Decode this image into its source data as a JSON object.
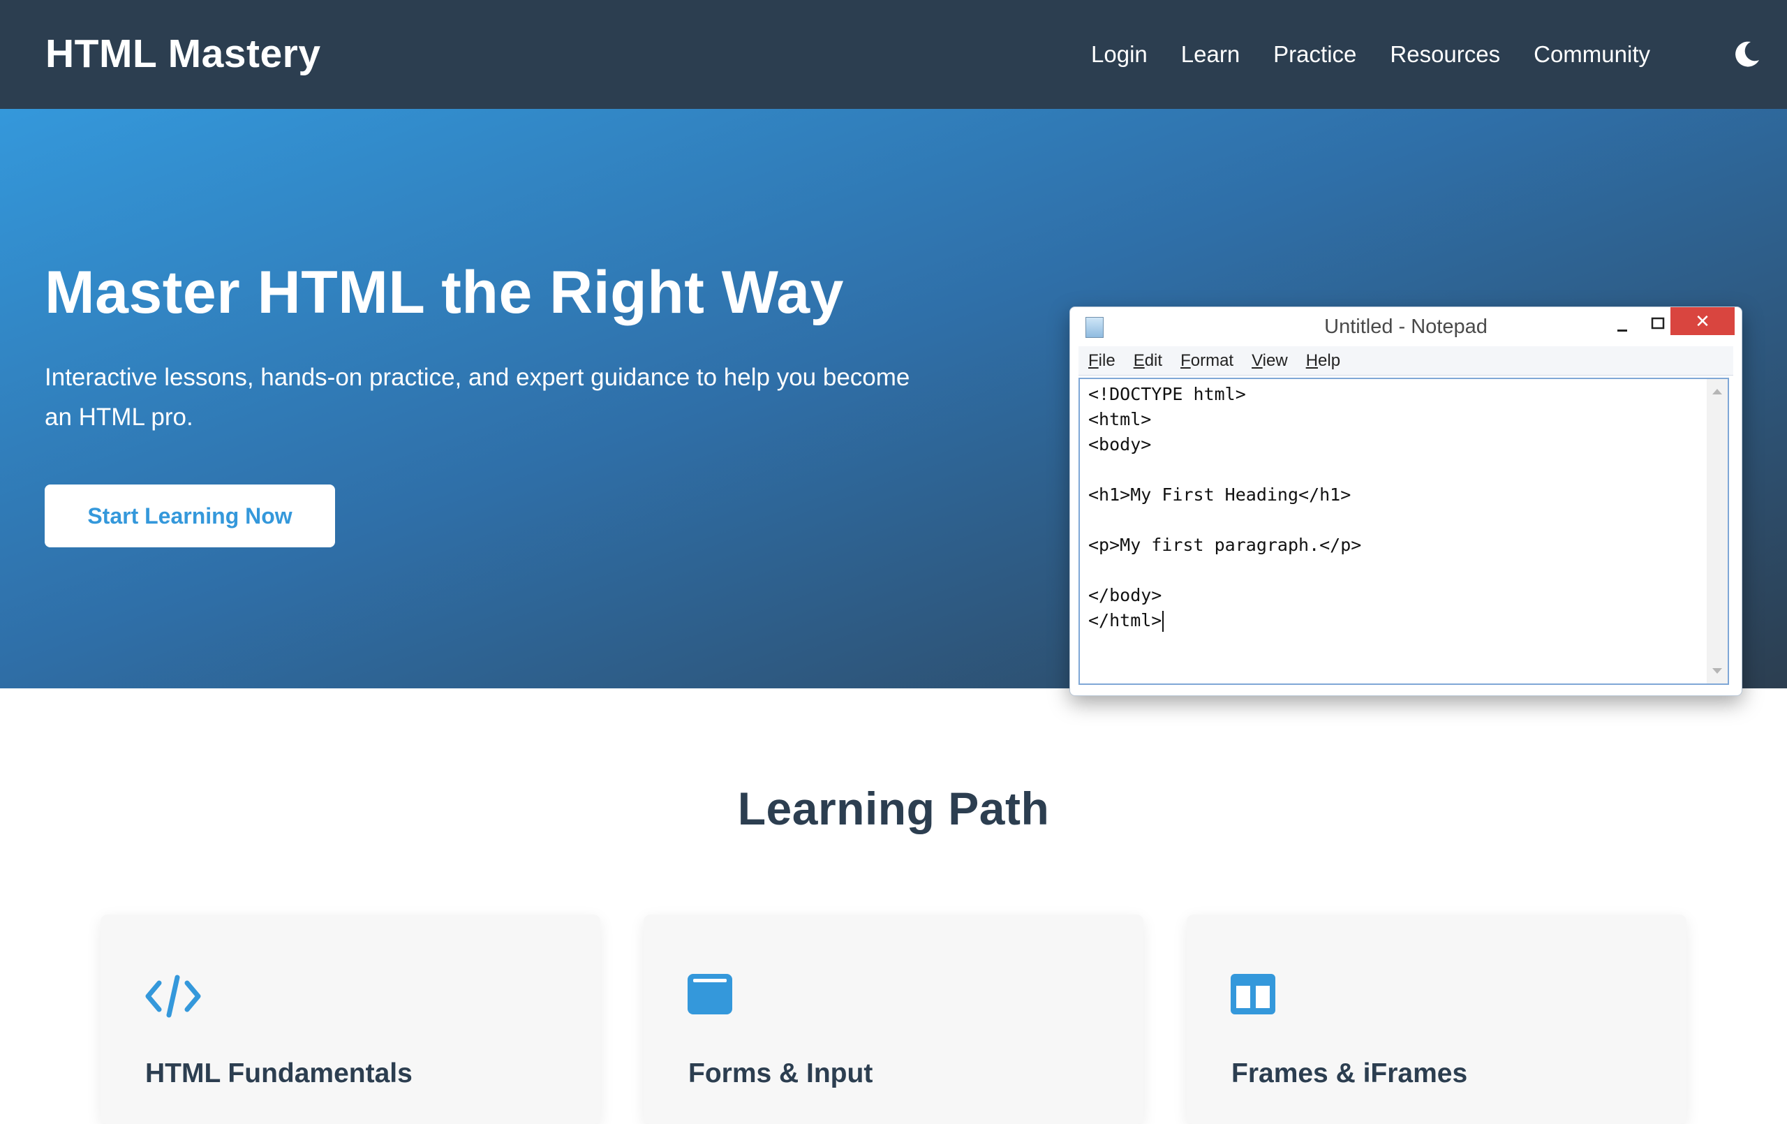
{
  "brand": "HTML Mastery",
  "nav": {
    "items": [
      "Login",
      "Learn",
      "Practice",
      "Resources",
      "Community"
    ],
    "theme_toggle_icon": "moon-icon"
  },
  "hero": {
    "title": "Master HTML the Right Way",
    "subtitle": "Interactive lessons, hands-on practice, and expert guidance to help you become an HTML pro.",
    "cta_label": "Start Learning Now"
  },
  "notepad": {
    "title": "Untitled - Notepad",
    "close_glyph": "✕",
    "menu": [
      "File",
      "Edit",
      "Format",
      "View",
      "Help"
    ],
    "code_lines": [
      "<!DOCTYPE html>",
      "<html>",
      "<body>",
      "",
      "<h1>My First Heading</h1>",
      "",
      "<p>My first paragraph.</p>",
      "",
      "</body>",
      "</html>"
    ]
  },
  "learning_path": {
    "title": "Learning Path",
    "cards": [
      {
        "title": "HTML Fundamentals",
        "icon": "code-icon"
      },
      {
        "title": "Forms & Input",
        "icon": "window-icon"
      },
      {
        "title": "Frames & iFrames",
        "icon": "columns-icon"
      }
    ]
  },
  "colors": {
    "nav_bg": "#2c3e50",
    "accent": "#3498db",
    "text_dark": "#2c3e50",
    "notepad_close": "#d9453f"
  }
}
